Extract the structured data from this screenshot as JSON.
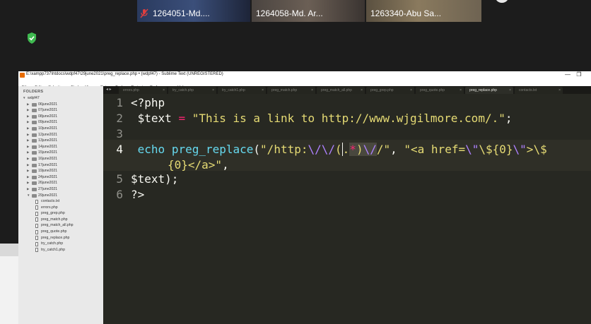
{
  "zoom": {
    "participants": [
      {
        "name": "1264051-Md....",
        "muted": true,
        "active": false
      },
      {
        "name": "1264058-Md. Ar...",
        "muted": false,
        "active": false
      },
      {
        "name": "1263340-Abu Sa...",
        "muted": false,
        "active": true
      }
    ],
    "colors": {
      "active_border": "#5fc35a",
      "shield": "#3fb950",
      "muted_mic": "#e03e3e"
    }
  },
  "window": {
    "title": "E:\\xampp737\\htdocs\\wdpf47\\29june2021\\preg_replace.php • (wdpf47) - Sublime Text (UNREGISTERED)",
    "controls": [
      "—",
      "❐"
    ]
  },
  "menu": [
    "File",
    "Edit",
    "Selection",
    "Find",
    "View",
    "Goto",
    "Tools",
    "Project",
    "Preferences",
    "Help"
  ],
  "sidebar": {
    "heading": "FOLDERS",
    "root": "wdpf47",
    "folders": [
      "06june2021",
      "07june2021",
      "08june2021",
      "09june2021",
      "10june2021",
      "12june2021",
      "13june2021",
      "14june2021",
      "15june2021",
      "16june2021",
      "17june2021",
      "19june2021",
      "24june2021",
      "26june2021",
      "27june2021"
    ],
    "open_folder": "29june2021",
    "files": [
      "contacts.txt",
      "errors.php",
      "preg_grep.php",
      "preg_match.php",
      "preg_match_all.php",
      "preg_quote.php",
      "preg_replace.php",
      "try_catch.php",
      "try_catch1.php"
    ]
  },
  "tabs": {
    "nav": "◂ ▸",
    "items": [
      {
        "label": "errors.php",
        "active": false
      },
      {
        "label": "try_catch.php",
        "active": false
      },
      {
        "label": "try_catch1.php",
        "active": false
      },
      {
        "label": "preg_match.php",
        "active": false
      },
      {
        "label": "preg_match_all.php",
        "active": false
      },
      {
        "label": "preg_grep.php",
        "active": false
      },
      {
        "label": "preg_quote.php",
        "active": false
      },
      {
        "label": "preg_replace.php",
        "active": true
      },
      {
        "label": "contacts.txt",
        "active": false
      }
    ],
    "close_glyph": "×"
  },
  "editor": {
    "line_numbers": [
      "1",
      "2",
      "3",
      "4",
      "5",
      "6"
    ],
    "current_line": "4",
    "lines": {
      "l1": "<?php",
      "l2_var": "$text",
      "l2_eq": "=",
      "l2_str": "\"This is a link to http://www.wjgilmore.com/.\"",
      "l2_end": ";",
      "l4_echo": "echo",
      "l4_fn": "preg_replace",
      "l4_paren": "(",
      "l4_s1a": "\"/http:",
      "l4_s1b": "\\/\\/",
      "l4_s1c": "(",
      "l4_s1d": ".",
      "l4_s1e": "*",
      "l4_s1f": ")",
      "l4_s1g": "\\/",
      "l4_s1h": "/\"",
      "l4_comma": ",",
      "l4_s2a": "\"<a href=",
      "l4_s2b": "\\\"",
      "l4_s2c": "\\${0}",
      "l4_s2d": "\\\"",
      "l4_s2e": ">",
      "l4_s2f": "\\$",
      "l4w_a": "{0}</a>\"",
      "l4w_b": ",",
      "l5": "$text);",
      "l6": "?>"
    }
  }
}
